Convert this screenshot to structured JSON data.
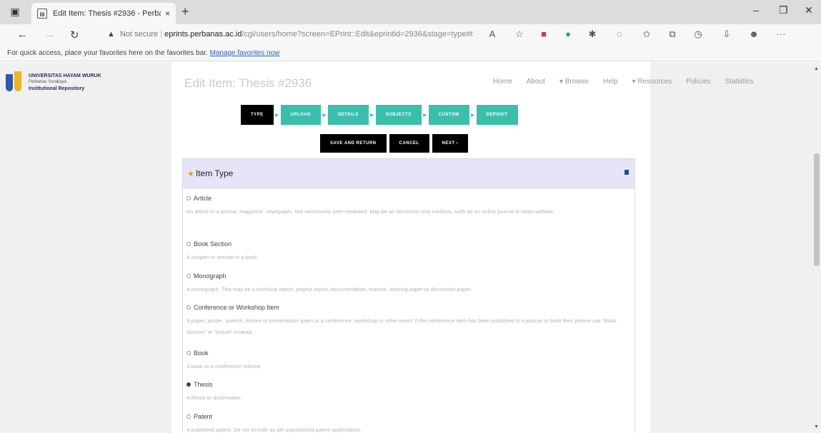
{
  "browser": {
    "tab_title": "Edit Item: Thesis #2936 - Perba...",
    "tab_close": "×",
    "new_tab": "+",
    "url_warning": "▲",
    "not_secure": "Not secure",
    "url_host": "eprints.perbanas.ac.id",
    "url_path": "/cgi/users/home?screen=EPrint::Edit&eprintid=2936&stage=type#t",
    "window_minimize": "–",
    "window_maximize": "❐",
    "window_close": "✕",
    "favbar_text": "For quick access, place your favorites here on the favorites bar.",
    "favbar_link": "Manage favorites now"
  },
  "brand": {
    "line1": "UNIVERSITAS HAYAM WURUK",
    "line2": "Perbanas Surabaya",
    "line3": "Institutional Repository"
  },
  "page": {
    "title": "Edit Item: Thesis #2936"
  },
  "nav": {
    "items": [
      "Home",
      "About",
      "▾ Browse",
      "Help",
      "▾ Resources",
      "Policies",
      "Statistics"
    ]
  },
  "workflow": {
    "steps": [
      "TYPE",
      "UPLOAD",
      "DETAILS",
      "SUBJECTS",
      "CUSTOM",
      "DEPOSIT"
    ],
    "current": "TYPE"
  },
  "actions": {
    "save": "SAVE AND RETURN",
    "cancel": "CANCEL",
    "next": "NEXT ›"
  },
  "item_type": {
    "heading": "Item Type",
    "required_marker": "★",
    "selected": "Thesis",
    "options": [
      {
        "label": "Article",
        "desc": "An article in a journal, magazine, newspaper. Not necessarily peer-reviewed. May be an electronic-only medium, such as an online journal or news website."
      },
      {
        "label": "Book Section",
        "desc": "A chapter or section in a book."
      },
      {
        "label": "Monograph",
        "desc": "A monograph. This may be a technical report, project report, documentation, manual, working paper or discussion paper."
      },
      {
        "label": "Conference or Workshop Item",
        "desc": "A paper, poster, speech, lecture or presentation given at a conference, workshop or other event. If the conference item has been published in a journal or book then please use \"Book Section\" or \"Article\" instead."
      },
      {
        "label": "Book",
        "desc": "A book or a conference volume."
      },
      {
        "label": "Thesis",
        "desc": "A thesis or dissertation."
      },
      {
        "label": "Patent",
        "desc": "A published patent. Do not include as yet unpublished patent applications."
      }
    ]
  },
  "colors": {
    "step_active": "#000000",
    "step_inactive": "#3bbfad",
    "panel_header": "#e5e5f7"
  }
}
